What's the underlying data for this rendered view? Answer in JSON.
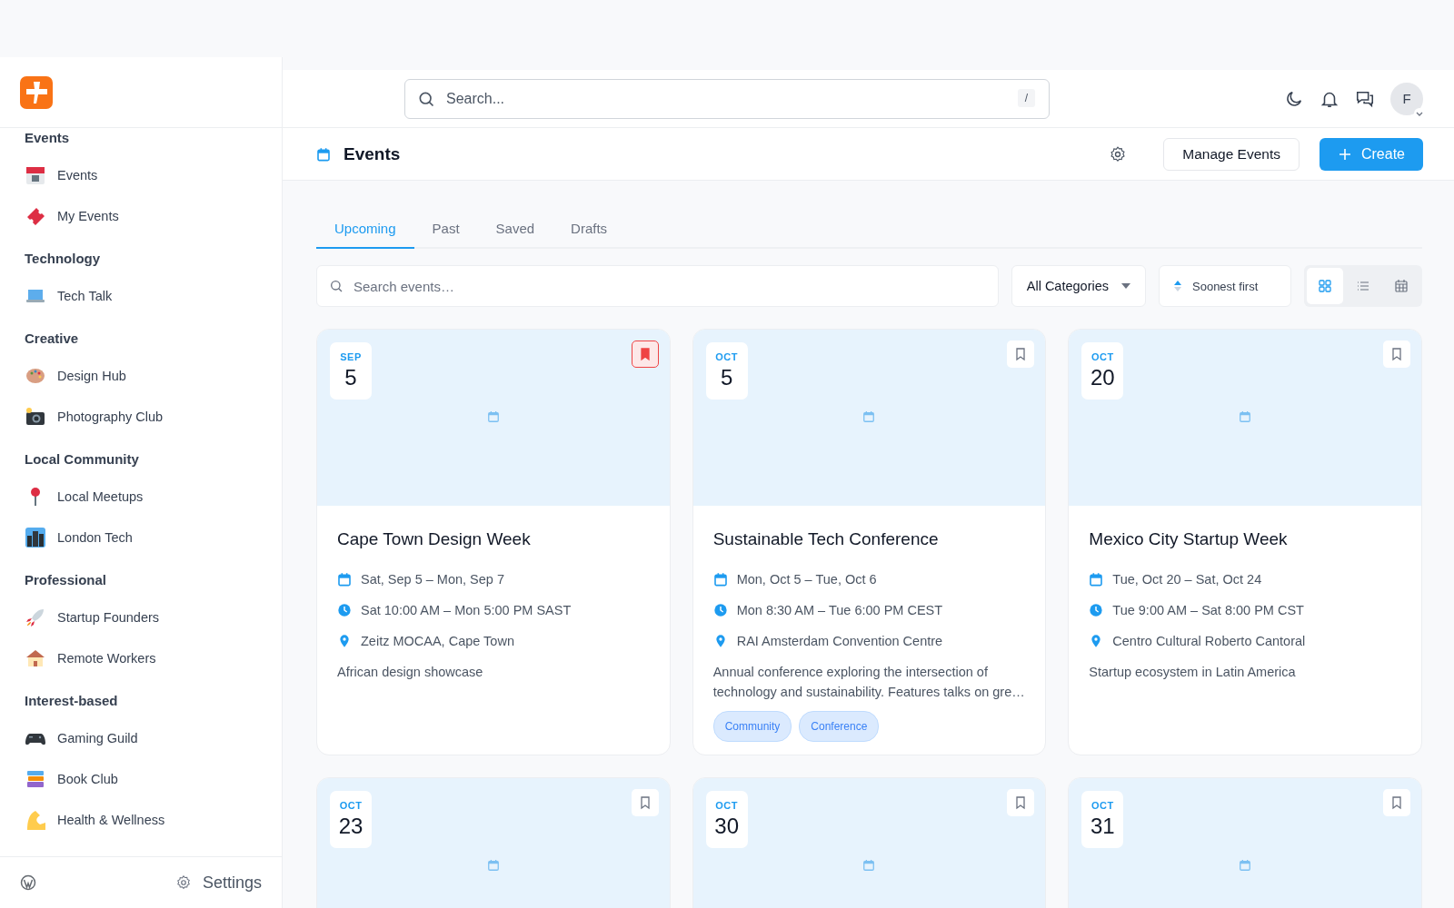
{
  "top_bar": {
    "search": {
      "placeholder": "Search...",
      "shortcut": "/"
    },
    "avatar": "F"
  },
  "sidebar": {
    "groups": [
      {
        "title": "Events",
        "items": [
          {
            "label": "Events"
          },
          {
            "label": "My Events"
          }
        ]
      },
      {
        "title": "Technology",
        "items": [
          {
            "label": "Tech Talk"
          }
        ]
      },
      {
        "title": "Creative",
        "items": [
          {
            "label": "Design Hub"
          },
          {
            "label": "Photography Club"
          }
        ]
      },
      {
        "title": "Local Community",
        "items": [
          {
            "label": "Local Meetups"
          },
          {
            "label": "London Tech"
          }
        ]
      },
      {
        "title": "Professional",
        "items": [
          {
            "label": "Startup Founders"
          },
          {
            "label": "Remote Workers"
          }
        ]
      },
      {
        "title": "Interest-based",
        "items": [
          {
            "label": "Gaming Guild"
          },
          {
            "label": "Book Club"
          },
          {
            "label": "Health & Wellness"
          }
        ]
      }
    ],
    "footer": {
      "settings": "Settings"
    }
  },
  "page_header": {
    "title": "Events",
    "manage_button": "Manage Events",
    "create_button": "Create"
  },
  "tabs": [
    {
      "label": "Upcoming",
      "selected": true
    },
    {
      "label": "Past",
      "selected": false
    },
    {
      "label": "Saved",
      "selected": false
    },
    {
      "label": "Drafts",
      "selected": false
    }
  ],
  "filters": {
    "search": {
      "placeholder": "Search events…"
    },
    "category": "All Categories",
    "sort": "Soonest first",
    "views": [
      {
        "kind": "grid",
        "selected": true
      },
      {
        "kind": "list",
        "selected": false
      },
      {
        "kind": "calendar",
        "selected": false
      }
    ]
  },
  "events": [
    {
      "month": "SEP",
      "day": "5",
      "saved": true,
      "title": "Cape Town Design Week",
      "dates": "Sat, Sep 5 – Mon, Sep 7",
      "times": "Sat 10:00 AM – Mon 5:00 PM SAST",
      "location": "Zeitz MOCAA, Cape Town",
      "description": "African design showcase"
    },
    {
      "month": "OCT",
      "day": "5",
      "saved": false,
      "title": "Sustainable Tech Conference",
      "dates": "Mon, Oct 5 – Tue, Oct 6",
      "times": "Mon 8:30 AM – Tue 6:00 PM CEST",
      "location": "RAI Amsterdam Convention Centre",
      "description": "Annual conference exploring the intersection of technology and sustainability. Features talks on gre…",
      "tags": [
        "Community",
        "Conference"
      ]
    },
    {
      "month": "OCT",
      "day": "20",
      "saved": false,
      "title": "Mexico City Startup Week",
      "dates": "Tue, Oct 20 – Sat, Oct 24",
      "times": "Tue 9:00 AM – Sat 8:00 PM CST",
      "location": "Centro Cultural Roberto Cantoral",
      "description": "Startup ecosystem in Latin America"
    },
    {
      "month": "OCT",
      "day": "23",
      "saved": false
    },
    {
      "month": "OCT",
      "day": "30",
      "saved": false
    },
    {
      "month": "OCT",
      "day": "31",
      "saved": false
    }
  ]
}
